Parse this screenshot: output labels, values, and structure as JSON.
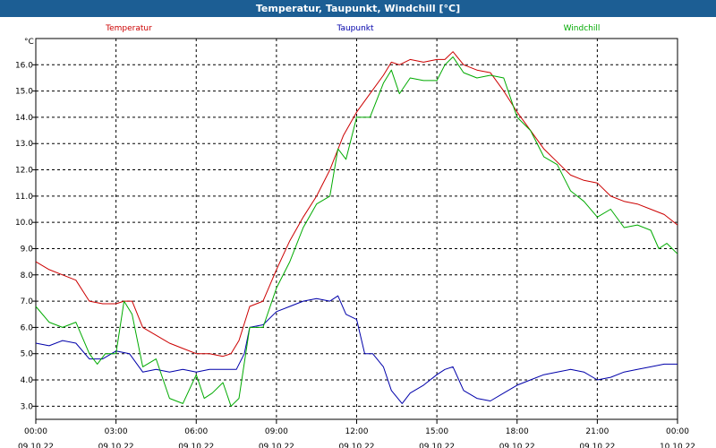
{
  "window": {
    "title": "Temperatur, Taupunkt, Windchill [°C]"
  },
  "colors": {
    "temperature": "#cc0000",
    "dewpoint": "#0000aa",
    "windchill": "#00aa00",
    "grid": "#000000",
    "background": "#ffffff"
  },
  "chart_data": {
    "type": "line",
    "title": "Temperatur, Taupunkt, Windchill [°C]",
    "unit_label": "°C",
    "ylim": [
      2.5,
      17.0
    ],
    "yticks": [
      3.0,
      4.0,
      5.0,
      6.0,
      7.0,
      8.0,
      9.0,
      10.0,
      11.0,
      12.0,
      13.0,
      14.0,
      15.0,
      16.0
    ],
    "ytick_labels": [
      "3.0",
      "4.0",
      "5.0",
      "6.0",
      "7.0",
      "8.0",
      "9.0",
      "10.0",
      "11.0",
      "12.0",
      "13.0",
      "14.0",
      "15.0",
      "16.0"
    ],
    "x_unit": "hours since 09.10.22 00:00",
    "xlim": [
      0,
      24
    ],
    "xticks": [
      {
        "x": 0,
        "time": "00:00",
        "date": "09.10.22"
      },
      {
        "x": 3,
        "time": "03:00",
        "date": "09.10.22"
      },
      {
        "x": 6,
        "time": "06:00",
        "date": "09.10.22"
      },
      {
        "x": 9,
        "time": "09:00",
        "date": "09.10.22"
      },
      {
        "x": 12,
        "time": "12:00",
        "date": "09.10.22"
      },
      {
        "x": 15,
        "time": "15:00",
        "date": "09.10.22"
      },
      {
        "x": 18,
        "time": "18:00",
        "date": "09.10.22"
      },
      {
        "x": 21,
        "time": "21:00",
        "date": "09.10.22"
      },
      {
        "x": 24,
        "time": "00:00",
        "date": "10.10.22"
      }
    ],
    "grid": true,
    "series": [
      {
        "name": "Temperatur",
        "color": "#cc0000",
        "x": [
          0,
          0.5,
          1,
          1.5,
          2,
          2.5,
          3,
          3.3,
          3.6,
          4,
          4.5,
          5,
          5.5,
          6,
          6.5,
          7,
          7.3,
          7.6,
          8,
          8.5,
          9,
          9.5,
          10,
          10.5,
          11,
          11.5,
          12,
          12.5,
          13,
          13.3,
          13.6,
          14,
          14.5,
          15,
          15.3,
          15.6,
          16,
          16.5,
          17,
          17.5,
          18,
          18.5,
          19,
          19.5,
          20,
          20.5,
          21,
          21.5,
          22,
          22.5,
          23,
          23.5,
          24
        ],
        "y": [
          8.5,
          8.2,
          8.0,
          7.8,
          7.0,
          6.9,
          6.9,
          7.0,
          7.0,
          6.0,
          5.7,
          5.4,
          5.2,
          5.0,
          5.0,
          4.9,
          5.0,
          5.5,
          6.8,
          7.0,
          8.2,
          9.3,
          10.2,
          11.0,
          12.0,
          13.3,
          14.2,
          14.9,
          15.6,
          16.1,
          16.0,
          16.2,
          16.1,
          16.2,
          16.2,
          16.5,
          16.0,
          15.8,
          15.7,
          15.0,
          14.2,
          13.5,
          12.8,
          12.3,
          11.8,
          11.6,
          11.5,
          11.0,
          10.8,
          10.7,
          10.5,
          10.3,
          9.9
        ]
      },
      {
        "name": "Taupunkt",
        "color": "#0000aa",
        "x": [
          0,
          0.5,
          1,
          1.5,
          2,
          2.5,
          3,
          3.5,
          4,
          4.5,
          5,
          5.5,
          6,
          6.5,
          7,
          7.5,
          7.8,
          8,
          8.5,
          9,
          9.5,
          10,
          10.5,
          11,
          11.3,
          11.6,
          12,
          12.3,
          12.6,
          13,
          13.3,
          13.7,
          14,
          14.5,
          15,
          15.3,
          15.6,
          16,
          16.5,
          17,
          17.5,
          18,
          18.5,
          19,
          19.5,
          20,
          20.5,
          21,
          21.5,
          22,
          22.5,
          23,
          23.5,
          24
        ],
        "y": [
          5.4,
          5.3,
          5.5,
          5.4,
          4.8,
          4.8,
          5.1,
          5.0,
          4.3,
          4.4,
          4.3,
          4.4,
          4.3,
          4.4,
          4.4,
          4.4,
          5.0,
          6.0,
          6.1,
          6.6,
          6.8,
          7.0,
          7.1,
          7.0,
          7.2,
          6.5,
          6.3,
          5.0,
          5.0,
          4.5,
          3.6,
          3.1,
          3.5,
          3.8,
          4.2,
          4.4,
          4.5,
          3.6,
          3.3,
          3.2,
          3.5,
          3.8,
          4.0,
          4.2,
          4.3,
          4.4,
          4.3,
          4.0,
          4.1,
          4.3,
          4.4,
          4.5,
          4.6,
          4.6
        ]
      },
      {
        "name": "Windchill",
        "color": "#00aa00",
        "x": [
          0,
          0.5,
          1,
          1.5,
          2,
          2.3,
          2.6,
          3,
          3.3,
          3.6,
          4,
          4.5,
          5,
          5.5,
          6,
          6.3,
          6.6,
          7,
          7.3,
          7.6,
          8,
          8.5,
          9,
          9.5,
          10,
          10.5,
          11,
          11.3,
          11.6,
          12,
          12.5,
          13,
          13.3,
          13.6,
          14,
          14.5,
          15,
          15.3,
          15.6,
          16,
          16.5,
          17,
          17.5,
          18,
          18.5,
          19,
          19.5,
          20,
          20.5,
          21,
          21.5,
          22,
          22.5,
          23,
          23.3,
          23.6,
          24
        ],
        "y": [
          6.8,
          6.2,
          6.0,
          6.2,
          5.0,
          4.6,
          5.0,
          5.0,
          7.0,
          6.5,
          4.5,
          4.8,
          3.3,
          3.1,
          4.2,
          3.3,
          3.5,
          3.9,
          3.0,
          3.3,
          6.0,
          6.0,
          7.5,
          8.5,
          9.8,
          10.7,
          11.0,
          12.8,
          12.4,
          14.0,
          14.0,
          15.3,
          15.8,
          14.9,
          15.5,
          15.4,
          15.4,
          16.0,
          16.3,
          15.7,
          15.5,
          15.6,
          15.5,
          14.0,
          13.5,
          12.5,
          12.2,
          11.2,
          10.8,
          10.2,
          10.5,
          9.8,
          9.9,
          9.7,
          9.0,
          9.2,
          8.8
        ]
      }
    ]
  }
}
